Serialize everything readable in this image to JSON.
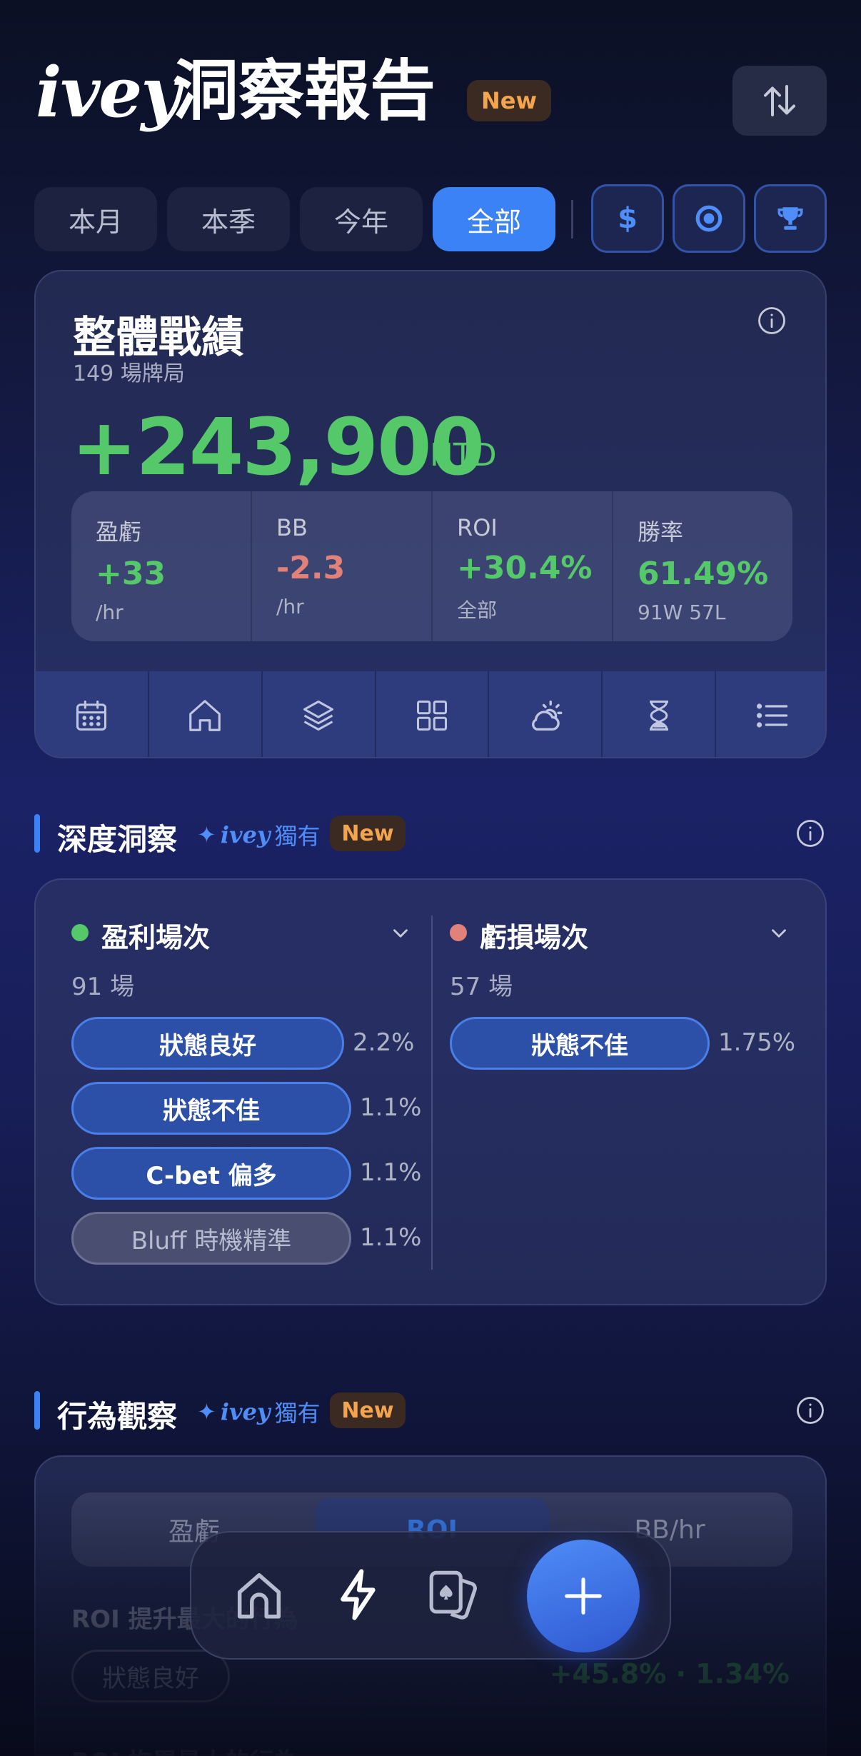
{
  "header": {
    "brand": "ivey",
    "title": "洞察報告",
    "badge": "New",
    "sort_icon": "sort-updown-icon"
  },
  "filters": {
    "periods": [
      "本月",
      "本季",
      "今年",
      "全部"
    ],
    "active": "全部",
    "icon_filters": [
      "dollar-icon",
      "chip-icon",
      "trophy-icon"
    ],
    "dollar_glyph": "$"
  },
  "overall": {
    "title": "整體戰績",
    "sessions": "149 場牌局",
    "amount": "+243,900",
    "unit": "NTD",
    "stats": [
      {
        "label": "盈虧",
        "value": "+33",
        "sub": "/hr",
        "tone": "pos"
      },
      {
        "label": "BB",
        "value": "-2.3",
        "sub": "/hr",
        "tone": "neg"
      },
      {
        "label": "ROI",
        "value": "+30.4%",
        "sub": "全部",
        "tone": "pos"
      },
      {
        "label": "勝率",
        "value": "61.49%",
        "sub": "91W 57L",
        "tone": "pos"
      }
    ],
    "tab_icons": [
      "calendar-icon",
      "home-icon",
      "layers-icon",
      "grid-icon",
      "weather-icon",
      "hourglass-icon",
      "list-icon"
    ]
  },
  "insight": {
    "title": "深度洞察",
    "exclusive_star": "✦",
    "exclusive_brand": "ivey",
    "exclusive_text": "獨有",
    "badge": "New",
    "win": {
      "title": "盈利場次",
      "count": "91 場",
      "color": "#55c96a",
      "chips": [
        {
          "label": "狀態良好",
          "pct": "2.2%"
        },
        {
          "label": "狀態不佳",
          "pct": "1.1%"
        },
        {
          "label": "C-bet 偏多",
          "pct": "1.1%"
        },
        {
          "label": "Bluff 時機精準",
          "pct": "1.1%"
        }
      ]
    },
    "loss": {
      "title": "虧損場次",
      "count": "57 場",
      "color": "#e08279",
      "chips": [
        {
          "label": "狀態不佳",
          "pct": "1.75%"
        }
      ]
    }
  },
  "behavior": {
    "title": "行為觀察",
    "exclusive_star": "✦",
    "exclusive_brand": "ivey",
    "exclusive_text": "獨有",
    "badge": "New",
    "segments": [
      "盈虧",
      "ROI",
      "BB/hr"
    ],
    "active_segment": "ROI",
    "label": "ROI 提升最大的行為",
    "chip": "狀態良好",
    "value": "+45.8%  ·  1.34%",
    "label2": "ROI 拖累最大的行為"
  },
  "bottom_nav": {
    "items": [
      "home-icon",
      "bolt-icon",
      "cards-icon"
    ],
    "fab": "add-icon"
  }
}
